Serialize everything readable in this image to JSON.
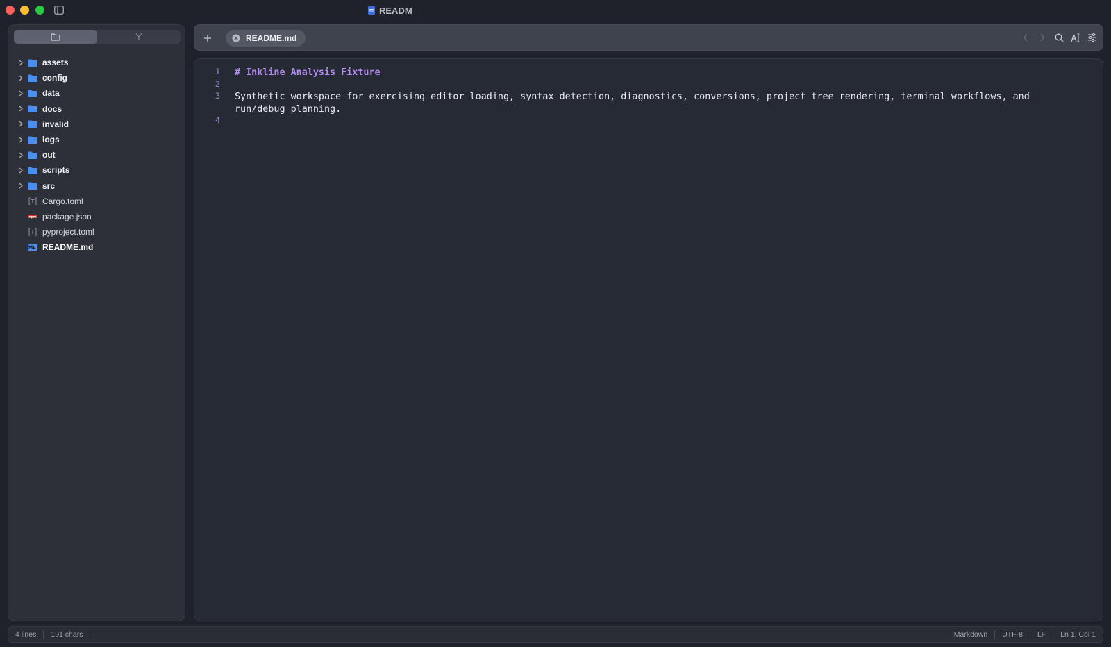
{
  "window": {
    "title": "READM",
    "colors": {
      "close": "#fe5f57",
      "minimize": "#febc2e",
      "maximize": "#28c840"
    }
  },
  "sidebar": {
    "tabs": [
      {
        "icon": "folder-icon",
        "active": true
      },
      {
        "icon": "source-control-icon",
        "active": false
      }
    ],
    "tree": [
      {
        "label": "assets",
        "kind": "folder"
      },
      {
        "label": "config",
        "kind": "folder"
      },
      {
        "label": "data",
        "kind": "folder"
      },
      {
        "label": "docs",
        "kind": "folder"
      },
      {
        "label": "invalid",
        "kind": "folder"
      },
      {
        "label": "logs",
        "kind": "folder"
      },
      {
        "label": "out",
        "kind": "folder"
      },
      {
        "label": "scripts",
        "kind": "folder"
      },
      {
        "label": "src",
        "kind": "folder"
      },
      {
        "label": "Cargo.toml",
        "kind": "toml"
      },
      {
        "label": "package.json",
        "kind": "npm"
      },
      {
        "label": "pyproject.toml",
        "kind": "toml"
      },
      {
        "label": "README.md",
        "kind": "markdown",
        "selected": true
      }
    ]
  },
  "tabbar": {
    "active_tab": "README.md",
    "right_icons": [
      "back-icon",
      "forward-icon",
      "search-icon",
      "font-size-icon",
      "settings-sliders-icon"
    ]
  },
  "editor": {
    "lines": [
      {
        "number": "1",
        "text": "# Inkline Analysis Fixture",
        "style": "heading"
      },
      {
        "number": "2",
        "text": "",
        "style": "plain"
      },
      {
        "number": "3",
        "text": "Synthetic workspace for exercising editor loading, syntax detection, diagnostics, conversions, project tree rendering, terminal workflows, and run/debug planning.",
        "style": "plain"
      },
      {
        "number": "4",
        "text": "",
        "style": "plain"
      }
    ],
    "colors": {
      "heading": "#b48df0",
      "line_number": "#9b8ad6"
    }
  },
  "statusbar": {
    "lines": "4 lines",
    "chars": "191 chars",
    "language": "Markdown",
    "encoding": "UTF-8",
    "line_ending": "LF",
    "position": "Ln 1, Col 1"
  }
}
